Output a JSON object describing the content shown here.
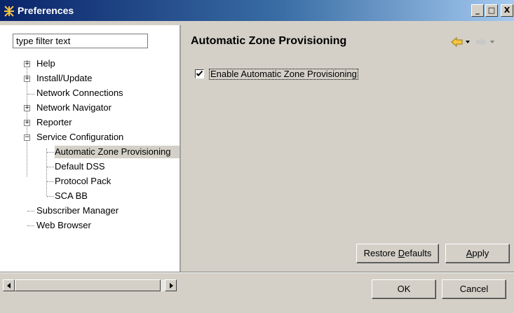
{
  "window": {
    "title": "Preferences",
    "minimize_label": "_",
    "maximize_label": "□",
    "close_label": "X"
  },
  "filter": {
    "value": "type filter text"
  },
  "tree": {
    "items": [
      {
        "label": "Help",
        "expander": "+"
      },
      {
        "label": "Install/Update",
        "expander": "+"
      },
      {
        "label": "Network Connections"
      },
      {
        "label": "Network Navigator",
        "expander": "+"
      },
      {
        "label": "Reporter",
        "expander": "+"
      },
      {
        "label": "Service Configuration",
        "expander": "−"
      },
      {
        "label": "Automatic Zone Provisioning",
        "selected": true
      },
      {
        "label": "Default DSS"
      },
      {
        "label": "Protocol Pack"
      },
      {
        "label": "SCA BB"
      },
      {
        "label": "Subscriber Manager"
      },
      {
        "label": "Web Browser"
      }
    ]
  },
  "page": {
    "title": "Automatic Zone Provisioning",
    "checkbox_label": "Enable Automatic Zone Provisioning",
    "checkbox_checked": true,
    "restore_defaults_pre": "Restore ",
    "restore_defaults_acc": "D",
    "restore_defaults_post": "efaults",
    "apply_acc": "A",
    "apply_post": "pply"
  },
  "dialog": {
    "ok_label": "OK",
    "cancel_label": "Cancel"
  },
  "colors": {
    "nav_back_arrow": "#f5c542",
    "nav_forward_arrow": "#c8c8c8",
    "title_bar": "#0a246a"
  }
}
